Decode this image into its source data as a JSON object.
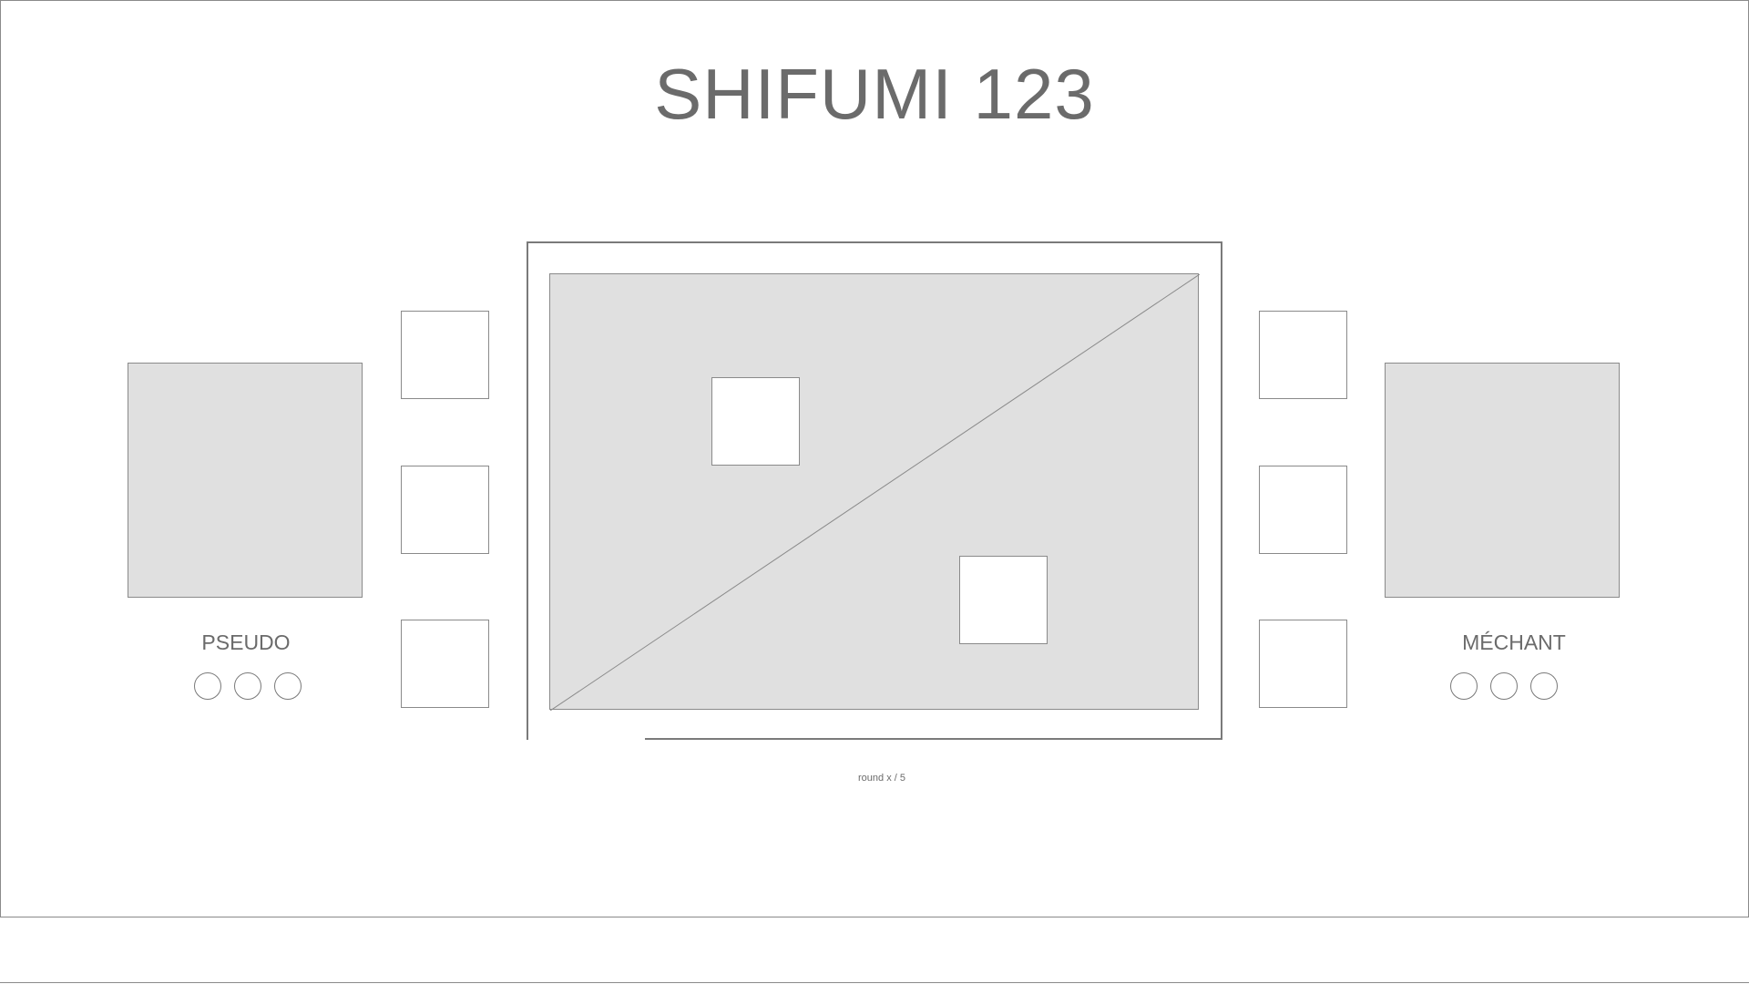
{
  "header": {
    "title": "SHIFUMI 123"
  },
  "player": {
    "name": "PSEUDO",
    "lives": 3
  },
  "opponent": {
    "name": "MÉCHANT",
    "lives": 3
  },
  "arena": {
    "round_text": "round x / 5"
  },
  "colors": {
    "placeholder_fill": "#e0e0e0",
    "stroke": "#8a8a8a",
    "text": "#6b6b6b",
    "background": "#ffffff"
  }
}
